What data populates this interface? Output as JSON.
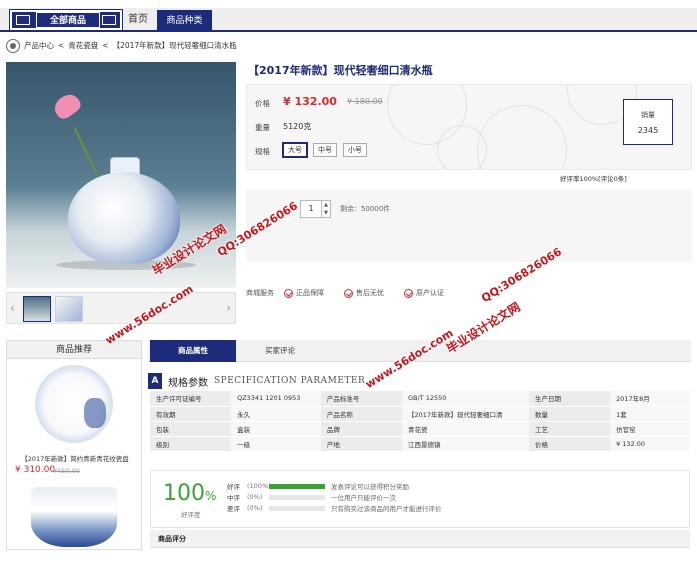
{
  "nav": {
    "all_goods": "全部商品",
    "home": "首页",
    "category": "商品种类"
  },
  "breadcrumb": {
    "center": "产品中心",
    "sep1": "<",
    "category": "青花瓷盘",
    "sep2": "<",
    "current": "【2017年新款】现代轻奢细口清水瓶"
  },
  "product": {
    "title": "【2017年新款】现代轻奢细口清水瓶",
    "price_label": "价格",
    "price": "¥ 132.00",
    "price_old": "¥ 180.00",
    "weight_label": "重量",
    "weight": "5120克",
    "size_label": "规格",
    "sizes": [
      "大号",
      "中号",
      "小号"
    ],
    "selected_size": "大号",
    "sales_label": "销量",
    "sales": "2345",
    "good_rate": "好评率100%[评论0条]",
    "quantity": "1",
    "stock": "剩余：50000件",
    "qty_up": "▲",
    "qty_down": "▼"
  },
  "service": {
    "label": "商城服务",
    "items": [
      "正品保障",
      "售后无忧",
      "原产认证"
    ]
  },
  "watermarks": {
    "site": "www.56doc.com",
    "qq": "QQ:306826066",
    "name": "毕业设计论文网"
  },
  "sidebar": {
    "title": "商品推荐",
    "item_name": "【2017年新款】简约青新青花纹瓷盘",
    "item_price": "¥ 310.00",
    "item_old_price": "¥450.00"
  },
  "tabs": {
    "active": "商品属性",
    "other": "买家评论"
  },
  "spec": {
    "letter": "A",
    "title_cn": "规格参数",
    "title_en": "SPECIFICATION PARAMETER",
    "rows": [
      [
        "生产许可证编号",
        "QZ3341 1201 0953",
        "产品标准号",
        "GB/T 12550",
        "生产日期",
        "2017年8月"
      ],
      [
        "有效期",
        "永久",
        "产品名称",
        "【2017年新款】现代轻奢细口清",
        "数量",
        "1套"
      ],
      [
        "包装",
        "盒装",
        "品牌",
        "青花瓷",
        "工艺",
        "仿官窑"
      ],
      [
        "级别",
        "一级",
        "产地",
        "江西景德镇",
        "价格",
        "¥ 132.00"
      ]
    ]
  },
  "review": {
    "score": "100",
    "score_unit": "%",
    "score_label": "好评度",
    "rows": [
      {
        "name": "好评",
        "pct": "(100%)",
        "fill": 100,
        "note": "发表评论可以获得积分奖励"
      },
      {
        "name": "中评",
        "pct": "(0%)",
        "fill": 0,
        "note": "一位用户只能评价一次"
      },
      {
        "name": "差评",
        "pct": "(0%)",
        "fill": 0,
        "note": "只有购买过该商品的用户才能进行评价"
      }
    ],
    "section_title": "商品评分"
  },
  "colors": {
    "brand": "#1d2b7a",
    "price": "#d8282e",
    "good": "#3aa336"
  }
}
